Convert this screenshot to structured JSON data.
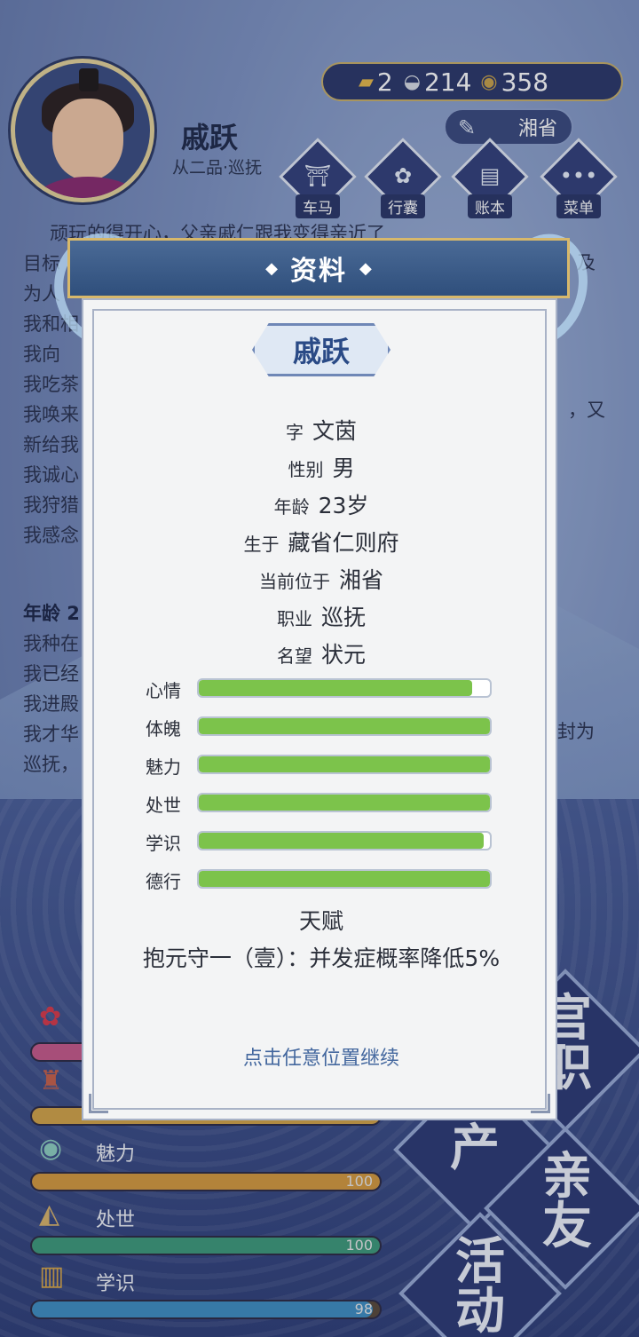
{
  "header": {
    "name": "戚跃",
    "rank": "从二品·巡抚",
    "currency": {
      "gold": "2",
      "silver": "214",
      "coin": "358"
    },
    "location": "湘省"
  },
  "nav": [
    {
      "label": "车马",
      "icon": "carriage-icon"
    },
    {
      "label": "行囊",
      "icon": "bag-icon"
    },
    {
      "label": "账本",
      "icon": "ledger-icon"
    },
    {
      "label": "菜单",
      "icon": "menu-dots-icon"
    }
  ],
  "log": {
    "lines": [
      "顽玩的得开心，父亲戚仁跟我变得亲近了",
      "目标",
      "为人",
      "我和相",
      "我向",
      "我吃茶",
      "我唤来",
      "新给我",
      "我诚心",
      "我狩猎",
      "我感念"
    ],
    "right_fragments": [
      "及",
      "，又",
      "封为"
    ],
    "section": "年龄 2",
    "lines2": [
      "我种在",
      "我已经",
      "我进殿",
      "我才华",
      "巡抚，"
    ]
  },
  "bg_stats": [
    {
      "label": "",
      "value": "",
      "fill": 1.0
    },
    {
      "label": "",
      "value": "",
      "fill": 1.0
    },
    {
      "label": "魅力",
      "value": "100",
      "fill": 1.0
    },
    {
      "label": "处世",
      "value": "100",
      "fill": 1.0
    },
    {
      "label": "学识",
      "value": "98",
      "fill": 0.98
    }
  ],
  "big_buttons": [
    "官职",
    "产",
    "亲友",
    "活动"
  ],
  "modal": {
    "title": "资料",
    "name": "戚跃",
    "info": [
      {
        "k": "字",
        "v": "文茵"
      },
      {
        "k": "性别",
        "v": "男"
      },
      {
        "k": "年龄",
        "v": "23岁"
      },
      {
        "k": "生于",
        "v": "藏省仁则府"
      },
      {
        "k": "当前位于",
        "v": "湘省"
      },
      {
        "k": "职业",
        "v": "巡抚"
      },
      {
        "k": "名望",
        "v": "状元"
      }
    ],
    "attributes": [
      {
        "label": "心情",
        "fill": 0.94
      },
      {
        "label": "体魄",
        "fill": 1.0
      },
      {
        "label": "魅力",
        "fill": 1.0
      },
      {
        "label": "处世",
        "fill": 1.0
      },
      {
        "label": "学识",
        "fill": 0.98
      },
      {
        "label": "德行",
        "fill": 1.0
      }
    ],
    "talent_heading": "天赋",
    "talent": "抱元守一（壹）：并发症概率降低5%",
    "continue": "点击任意位置继续"
  }
}
